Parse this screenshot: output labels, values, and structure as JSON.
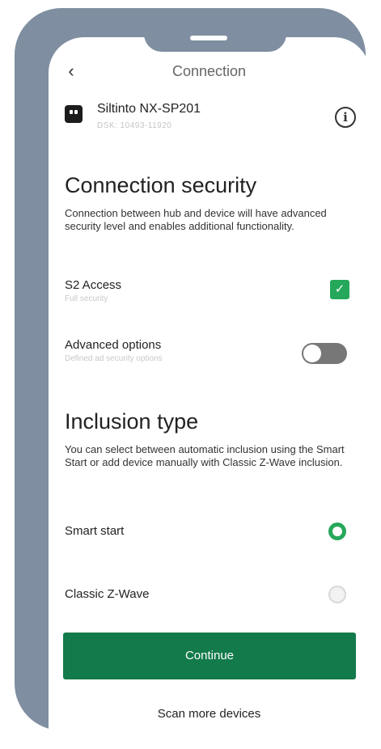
{
  "header": {
    "title": "Connection",
    "back_icon": "chevron-left-icon"
  },
  "device": {
    "name": "Siltinto NX-SP201",
    "id": "DSK: 10493-11920",
    "info_icon": "info-icon"
  },
  "connection_security": {
    "heading": "Connection security",
    "description": "Connection between hub and device will have advanced security level and enables additional functionality."
  },
  "s2_access": {
    "label": "S2 Access",
    "sublabel": "Full security",
    "checked": true,
    "check_mark": "✓"
  },
  "advanced_options": {
    "label": "Advanced options",
    "sublabel": "Defined ad security options",
    "enabled": false
  },
  "inclusion": {
    "heading": "Inclusion type",
    "description": "You can select between automatic inclusion using the Smart Start or add device manually with Classic Z-Wave inclusion.",
    "options": [
      {
        "label": "Smart start",
        "selected": true
      },
      {
        "label": "Classic Z-Wave",
        "selected": false
      }
    ]
  },
  "actions": {
    "continue_label": "Continue",
    "scan_label": "Scan more devices"
  },
  "colors": {
    "accent_green": "#25a85a",
    "button_green": "#137a4b",
    "frame": "#7f8ea0"
  }
}
